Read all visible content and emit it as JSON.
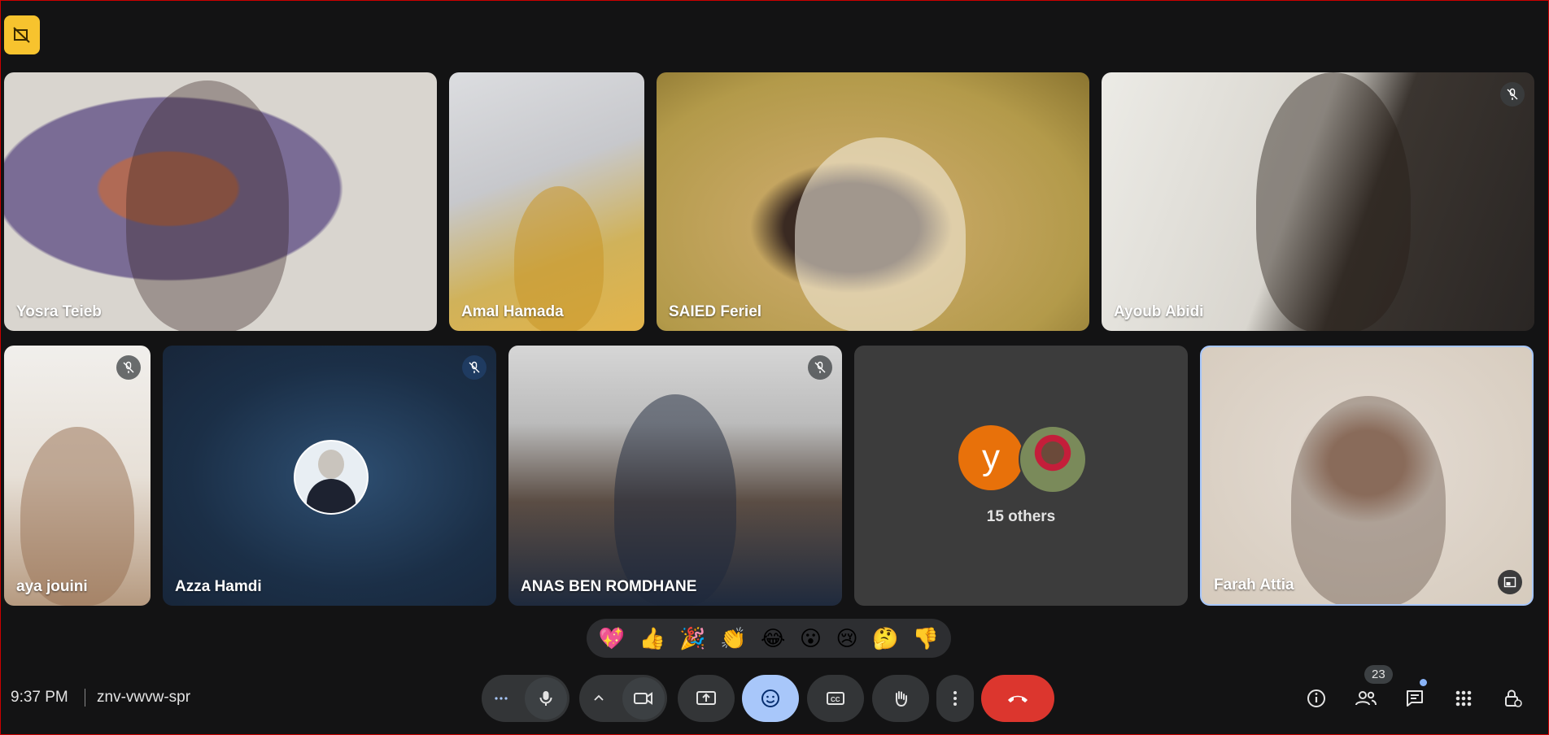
{
  "meeting": {
    "time": "9:37 PM",
    "code": "znv-vwvw-spr"
  },
  "participants": [
    {
      "name": "Yosra Teieb",
      "muted": false
    },
    {
      "name": "Amal Hamada",
      "muted": false
    },
    {
      "name": "SAIED Feriel",
      "muted": false
    },
    {
      "name": "Ayoub Abidi",
      "muted": true
    },
    {
      "name": "aya jouini",
      "muted": true
    },
    {
      "name": "Azza Hamdi",
      "muted": true
    },
    {
      "name": "ANAS BEN ROMDHANE",
      "muted": true
    },
    {
      "name": "Farah Attia",
      "muted": false
    }
  ],
  "others": {
    "initial": "y",
    "label": "15 others"
  },
  "reactions": [
    "💖",
    "👍",
    "🎉",
    "👏",
    "😂",
    "😮",
    "😢",
    "🤔",
    "👎"
  ],
  "people_count": "23",
  "colors": {
    "background": "#131314",
    "control": "#333537",
    "active": "#a8c7fa",
    "end_call": "#dc362e",
    "badge": "#f7c32e",
    "others_avatar": "#e8710a"
  },
  "icons": {
    "top_badge": "no-recording-icon",
    "mic": "mic-icon",
    "camera": "camera-icon",
    "present": "present-screen-icon",
    "emoji": "emoji-icon",
    "captions": "captions-icon",
    "raise_hand": "raise-hand-icon",
    "more": "more-vert-icon",
    "end_call": "end-call-icon",
    "info": "info-icon",
    "people": "people-icon",
    "chat": "chat-icon",
    "activities": "activities-icon",
    "host_controls": "host-controls-icon"
  }
}
